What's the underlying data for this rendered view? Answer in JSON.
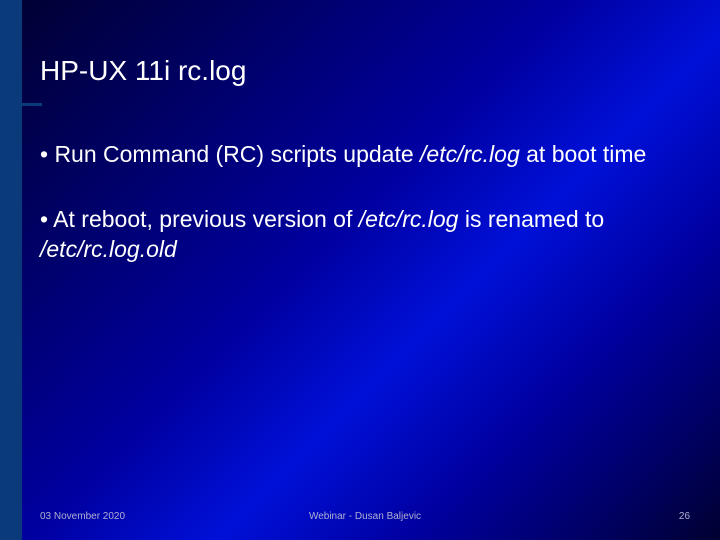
{
  "slide": {
    "title": "HP-UX 11i rc.log",
    "bullets": [
      {
        "prefix": "• Run Command (RC) scripts update ",
        "italic1": "/etc/rc.log",
        "suffix": " at boot time"
      },
      {
        "prefix": "• At reboot, previous version of ",
        "italic1": "/etc/rc.log",
        "mid": " is renamed to ",
        "italic2": "/etc/rc.log.old"
      }
    ],
    "footer": {
      "date": "03 November 2020",
      "center": "Webinar - Dusan Baljevic",
      "page": "26"
    }
  }
}
